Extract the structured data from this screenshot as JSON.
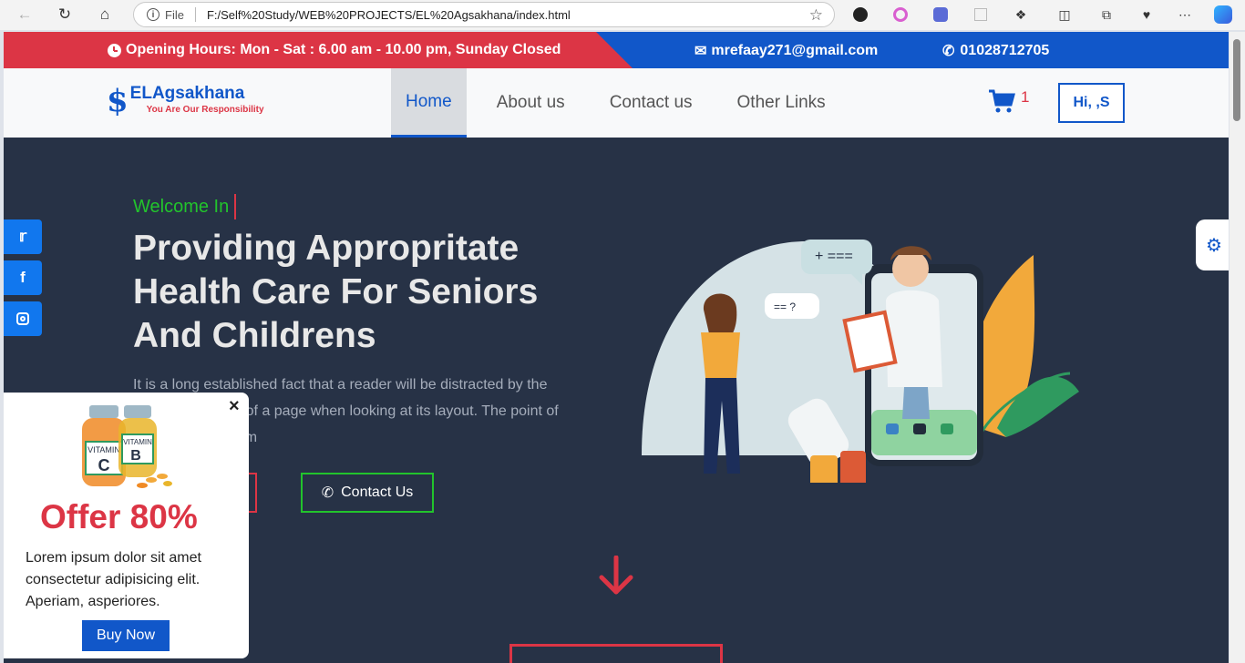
{
  "browser": {
    "file_label": "File",
    "url": "F:/Self%20Study/WEB%20PROJECTS/EL%20Agsakhana/index.html"
  },
  "topbar": {
    "hours": "Opening Hours: Mon - Sat : 6.00 am - 10.00 pm, Sunday Closed",
    "email": "mrefaay271@gmail.com",
    "phone": "01028712705"
  },
  "navbar": {
    "logo_name": "ELAgsakhana",
    "logo_tagline": "You Are Our Responsibility",
    "items": [
      "Home",
      "About us",
      "Contact us",
      "Other Links"
    ],
    "cart_count": "1",
    "user_label": "Hi, ,S"
  },
  "hero": {
    "welcome": "Welcome In",
    "headline": "Providing Appropritate Health Care For Seniors And Childrens",
    "paragraph": "It is a long established fact that a reader will be distracted by the readable content of a page when looking at its layout. The point of using Lorem Ipsum",
    "contact_button": "Contact Us"
  },
  "offer": {
    "title": "Offer 80%",
    "description": "Lorem ipsum dolor sit amet consectetur adipisicing elit. Aperiam, asperiores.",
    "buy_label": "Buy Now",
    "close": "×"
  },
  "social": [
    "twitter-icon",
    "facebook-icon",
    "instagram-icon"
  ],
  "colors": {
    "primary": "#1157c9",
    "danger": "#dc3545",
    "success": "#22c42c",
    "hero_bg": "#273246"
  }
}
